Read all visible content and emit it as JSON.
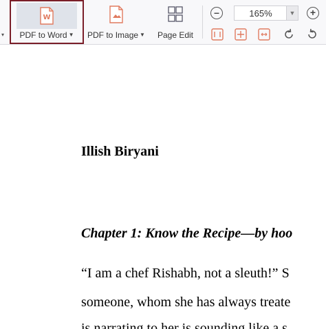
{
  "toolbar": {
    "pdf_to_word_label": "PDF to Word",
    "pdf_to_image_label": "PDF to Image",
    "page_edit_label": "Page Edit",
    "zoom_value": "165%",
    "colors": {
      "active_border": "#7a1e28",
      "icon_accent": "#e07a5f"
    }
  },
  "document": {
    "title": "Illish Biryani",
    "chapter": "Chapter 1: Know the Recipe—by hoo",
    "paragraph_lines": [
      "“I am a chef Rishabh, not a sleuth!” S",
      "someone, whom she has always treate",
      "is narrating to her is sounding like a s"
    ]
  }
}
